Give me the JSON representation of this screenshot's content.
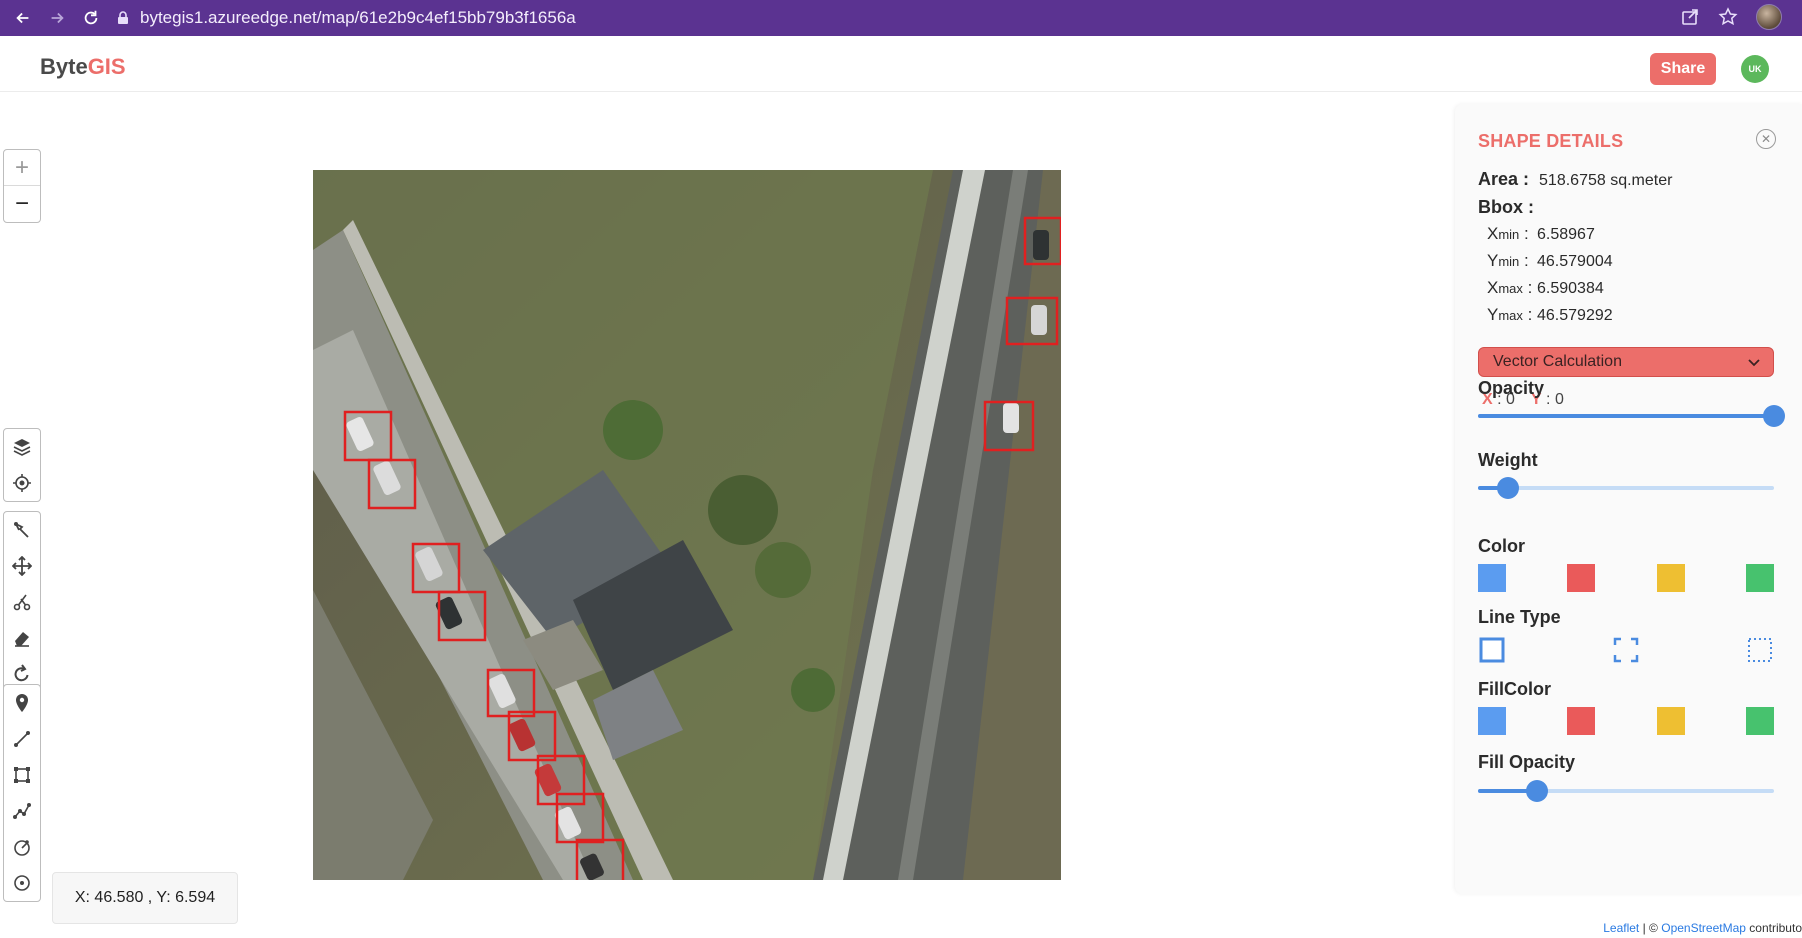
{
  "browser": {
    "url": "bytegis1.azureedge.net/map/61e2b9c4ef15bb79b3f1656a"
  },
  "header": {
    "logo_part1": "Byte",
    "logo_part2": "GIS",
    "share_label": "Share",
    "user_initials": "UK"
  },
  "map": {
    "zoom_in_label": "+",
    "zoom_out_label": "−",
    "cursor_coords": "X: 46.580 , Y: 6.594",
    "attribution_leaflet": "Leaflet",
    "attribution_sep": " | © ",
    "attribution_osm": "OpenStreetMap",
    "attribution_suffix": " contributo"
  },
  "panel": {
    "title": "SHAPE DETAILS",
    "area_label": "Area :",
    "area_value": "518.6758 sq.meter",
    "bbox_label": "Bbox :",
    "bbox": [
      {
        "key": "X",
        "sub": "min",
        "value": "6.58967"
      },
      {
        "key": "Y",
        "sub": "min",
        "value": "46.579004"
      },
      {
        "key": "X",
        "sub": "max",
        "value": "6.590384"
      },
      {
        "key": "Y",
        "sub": "max",
        "value": "46.579292"
      }
    ],
    "dropdown_value": "Vector Calculation",
    "x_key": "X",
    "x_val": ": 0",
    "y_key": "Y",
    "y_val": ": 0",
    "opacity_label": "Opacity",
    "opacity_value": 1.0,
    "weight_label": "Weight",
    "weight_value": 0.1,
    "color_label": "Color",
    "colors": [
      "#5b9cf0",
      "#ea5a5a",
      "#eebf32",
      "#47c26e"
    ],
    "line_type_label": "Line Type",
    "line_types": [
      "solid",
      "dashed-corners",
      "dotted"
    ],
    "fill_color_label": "FillColor",
    "fill_colors": [
      "#5b9cf0",
      "#ea5a5a",
      "#eebf32",
      "#47c26e"
    ],
    "fill_opacity_label": "Fill Opacity",
    "fill_opacity_value": 0.2
  }
}
